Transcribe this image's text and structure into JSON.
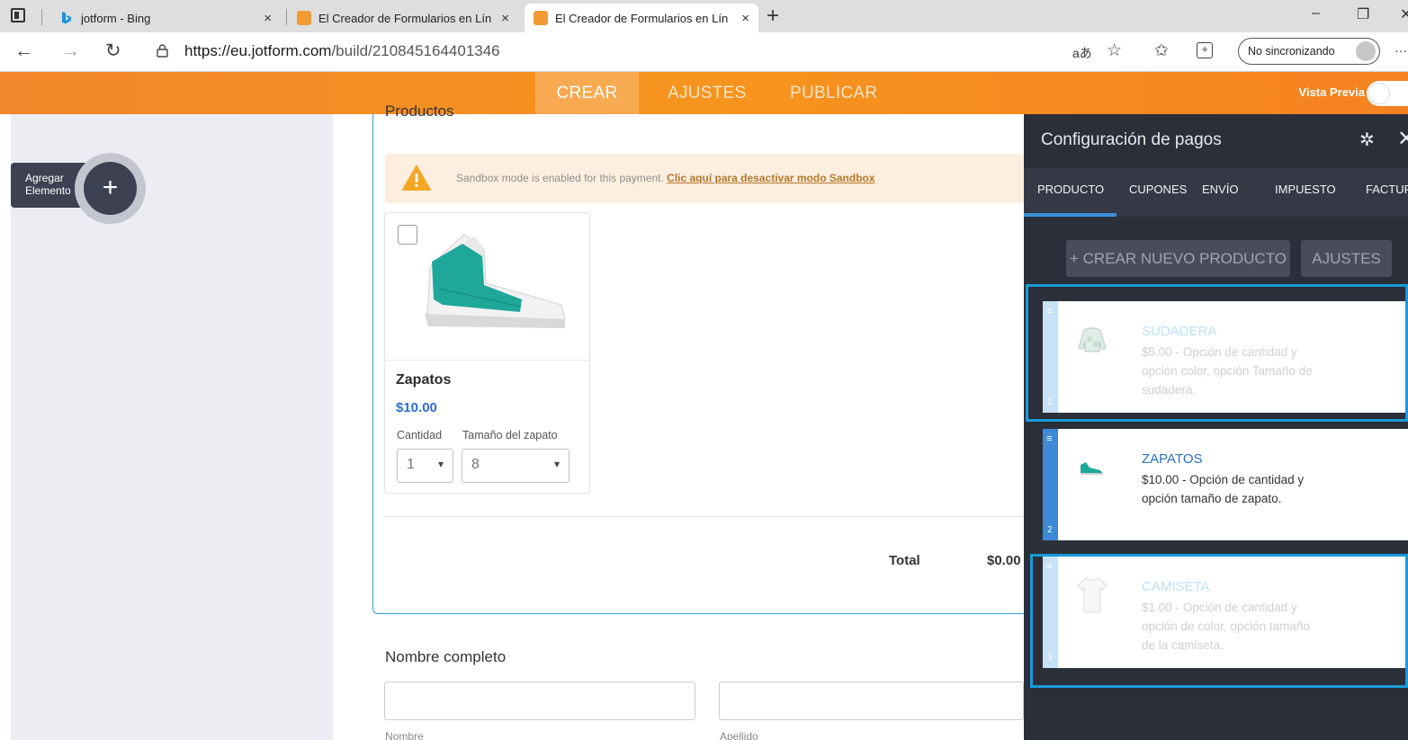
{
  "browser": {
    "tabs": [
      {
        "title": "jotform - Bing",
        "close": "×"
      },
      {
        "title": "El Creador de Formularios en Lín",
        "close": "×"
      },
      {
        "title": "El Creador de Formularios en Lín",
        "close": "×"
      }
    ],
    "new_tab": "+",
    "window_controls": {
      "minimize": "–",
      "restore": "❐",
      "close": "✕"
    },
    "url_host": "https://eu.jotform.com",
    "url_path": "/build/210845164401346",
    "sync_label": "No sincronizando",
    "more": "···",
    "read_aloud": "aあ"
  },
  "topnav": {
    "items": [
      "CREAR",
      "AJUSTES",
      "PUBLICAR"
    ],
    "preview_label": "Vista Previa"
  },
  "sidebar": {
    "add_element_line1": "Agregar",
    "add_element_line2": "Elemento",
    "add_icon": "+"
  },
  "form": {
    "products_title": "Productos",
    "sandbox_text": "Sandbox mode is enabled for this payment.",
    "sandbox_link": "Clic aquí para desactivar modo Sandbox",
    "product": {
      "name": "Zapatos",
      "price": "$10.00",
      "qty_label": "Cantidad",
      "size_label": "Tamaño del zapato",
      "qty_value": "1",
      "size_value": "8"
    },
    "total_label": "Total",
    "total_value": "$0.00",
    "fullname_label": "Nombre completo",
    "first_sublabel": "Nombre",
    "last_sublabel": "Apellido"
  },
  "panel": {
    "title": "Configuración de pagos",
    "tabs": [
      "PRODUCTO",
      "CUPONES",
      "ENVÍO",
      "IMPUESTO",
      "FACTURA"
    ],
    "create_button": "+ CREAR NUEVO PRODUCTO",
    "settings_button": "AJUSTES",
    "items": [
      {
        "index": "1",
        "title": "SUDADERA",
        "desc": "$5.00 - Opción de cantidad y opción color, opción Tamaño de sudadera."
      },
      {
        "index": "2",
        "title": "ZAPATOS",
        "desc": "$10.00 - Opción de cantidad y opción tamaño de zapato."
      },
      {
        "index": "3",
        "title": "CAMISETA",
        "desc": "$1.00 - Opción de cantidad y opción de color, opción tamaño de la camiseta."
      }
    ]
  },
  "colors": {
    "brand_orange": "#f7941e",
    "panel_dark": "#2b2f3a",
    "highlight_blue": "#189bd9",
    "price_blue": "#2d6ed8"
  }
}
